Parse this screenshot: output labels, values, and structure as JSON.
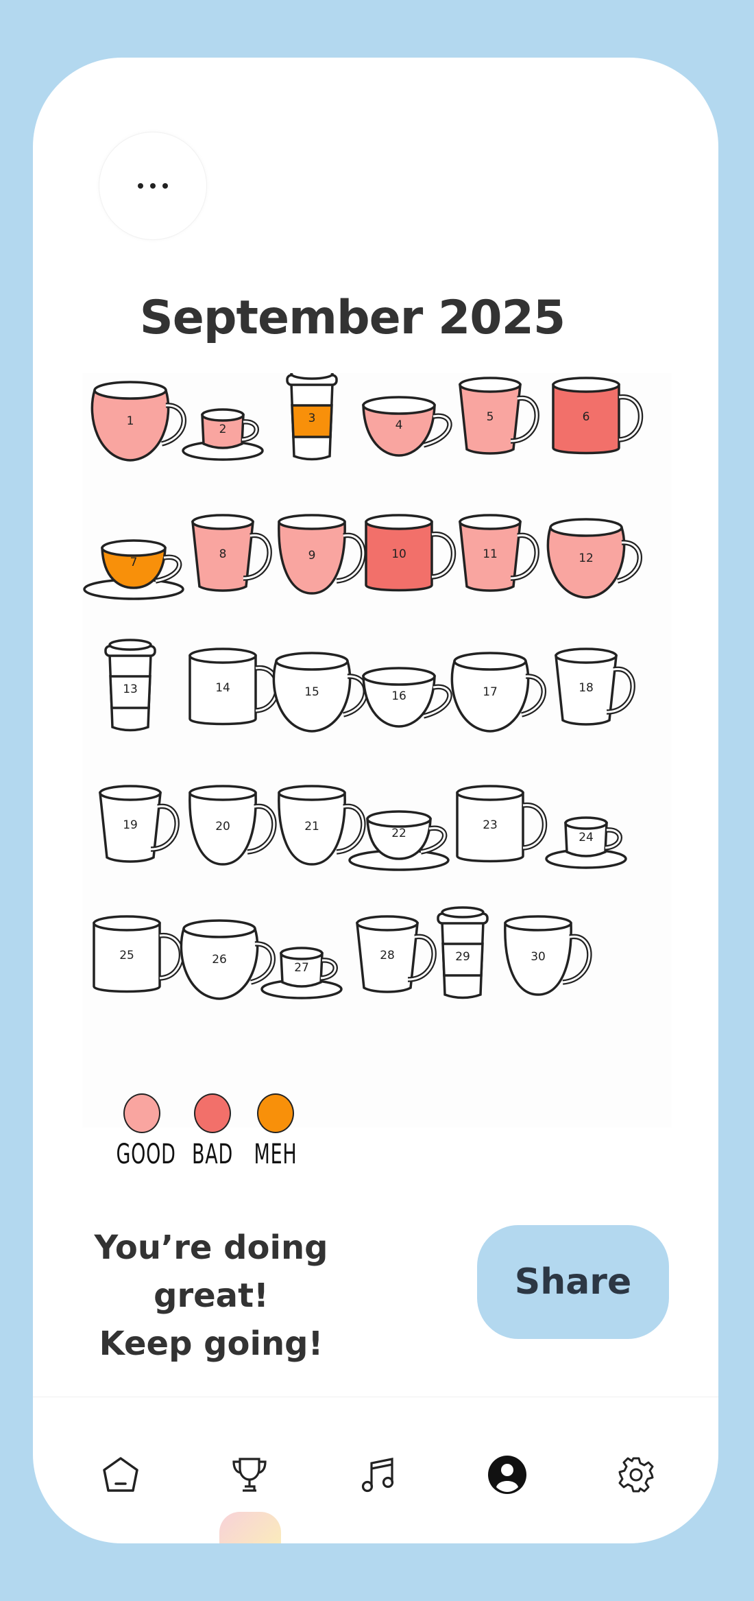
{
  "header": {
    "menu_label": "More options"
  },
  "calendar": {
    "title": "September 2025",
    "days": [
      {
        "n": "1",
        "style": "round",
        "mood": "good"
      },
      {
        "n": "2",
        "style": "saucer-small",
        "mood": "good"
      },
      {
        "n": "3",
        "style": "togo",
        "mood": "meh"
      },
      {
        "n": "4",
        "style": "bowl",
        "mood": "good"
      },
      {
        "n": "5",
        "style": "taper",
        "mood": "good"
      },
      {
        "n": "6",
        "style": "mug",
        "mood": "bad"
      },
      {
        "n": "7",
        "style": "saucer-bowl",
        "mood": "meh"
      },
      {
        "n": "8",
        "style": "taper",
        "mood": "good"
      },
      {
        "n": "9",
        "style": "vmug",
        "mood": "good"
      },
      {
        "n": "10",
        "style": "mug",
        "mood": "bad"
      },
      {
        "n": "11",
        "style": "taper",
        "mood": "good"
      },
      {
        "n": "12",
        "style": "round",
        "mood": "good"
      },
      {
        "n": "13",
        "style": "togo",
        "mood": "none"
      },
      {
        "n": "14",
        "style": "mug",
        "mood": "none"
      },
      {
        "n": "15",
        "style": "round",
        "mood": "none"
      },
      {
        "n": "16",
        "style": "bowl",
        "mood": "none"
      },
      {
        "n": "17",
        "style": "round",
        "mood": "none"
      },
      {
        "n": "18",
        "style": "taper",
        "mood": "none"
      },
      {
        "n": "19",
        "style": "taper",
        "mood": "none"
      },
      {
        "n": "20",
        "style": "vmug",
        "mood": "none"
      },
      {
        "n": "21",
        "style": "vmug",
        "mood": "none"
      },
      {
        "n": "22",
        "style": "saucer-bowl",
        "mood": "none"
      },
      {
        "n": "23",
        "style": "mug",
        "mood": "none"
      },
      {
        "n": "24",
        "style": "saucer-small",
        "mood": "none"
      },
      {
        "n": "25",
        "style": "mug",
        "mood": "none"
      },
      {
        "n": "26",
        "style": "round",
        "mood": "none"
      },
      {
        "n": "27",
        "style": "saucer-small",
        "mood": "none"
      },
      {
        "n": "28",
        "style": "taper",
        "mood": "none"
      },
      {
        "n": "29",
        "style": "togo",
        "mood": "none"
      },
      {
        "n": "30",
        "style": "vmug",
        "mood": "none"
      }
    ]
  },
  "colors": {
    "good": "#f9a5a0",
    "bad": "#f2706a",
    "meh": "#f8900a",
    "none": "#ffffff"
  },
  "legend": [
    {
      "label": "GOOD",
      "mood": "good"
    },
    {
      "label": "BAD",
      "mood": "bad"
    },
    {
      "label": "MEH",
      "mood": "meh"
    }
  ],
  "message": {
    "line1": "You’re doing great!",
    "line2": "Keep going!"
  },
  "share_label": "Share",
  "nav": [
    {
      "icon": "home-icon",
      "active": false
    },
    {
      "icon": "trophy-icon",
      "active": false
    },
    {
      "icon": "music-icon",
      "active": false
    },
    {
      "icon": "profile-icon",
      "active": true
    },
    {
      "icon": "settings-icon",
      "active": false
    }
  ]
}
